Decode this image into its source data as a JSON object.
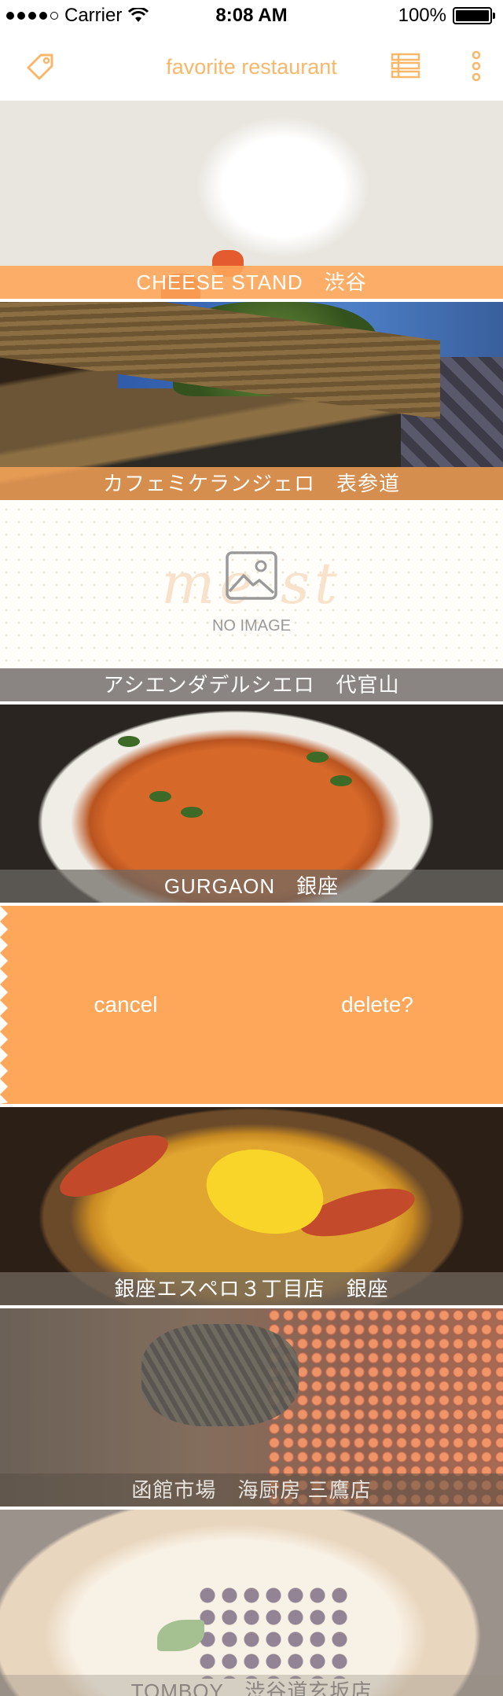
{
  "status_bar": {
    "carrier": "Carrier",
    "time": "8:08 AM",
    "battery_percent": "100%",
    "signal_bars": 4
  },
  "nav": {
    "title": "favorite restaurant",
    "left_icon": "tag-icon",
    "right_icons": [
      "list-icon",
      "more-vertical-icon"
    ]
  },
  "accent_color": "#fea659",
  "placeholder": {
    "watermark": "me st",
    "text": "NO IMAGE"
  },
  "restaurants": [
    {
      "label": "CHEESE STAND　渋谷"
    },
    {
      "label": "カフェミケランジェロ　表参道"
    },
    {
      "label": "アシエンダデルシエロ　代官山"
    },
    {
      "label": "GURGAON　銀座"
    },
    {
      "label": "銀座エスペロ３丁目店　銀座"
    },
    {
      "label": "函館市場　海厨房 三鷹店"
    },
    {
      "label": "TOMBOY　渋谷道玄坂店"
    }
  ],
  "swipe_actions": {
    "cancel_label": "cancel",
    "delete_label": "delete?"
  }
}
